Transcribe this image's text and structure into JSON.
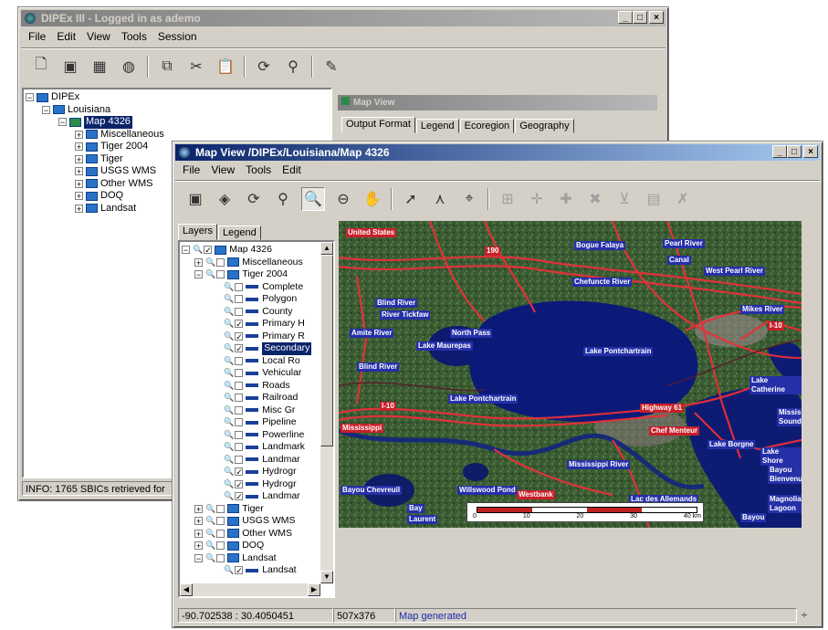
{
  "main_window": {
    "title": "DIPEx III - Logged in as ademo",
    "menus": [
      "File",
      "Edit",
      "View",
      "Tools",
      "Session"
    ],
    "tree": {
      "root": "DIPEx",
      "state": "Louisiana",
      "map": "Map 4326",
      "children": [
        "Miscellaneous",
        "Tiger 2004",
        "Tiger",
        "USGS WMS",
        "Other WMS",
        "DOQ",
        "Landsat"
      ]
    },
    "status": "INFO: 1765 SBICs retrieved for"
  },
  "map_view_panel": {
    "title": "Map View",
    "tabs": [
      "Output Format",
      "Legend",
      "Ecoregion",
      "Geography"
    ]
  },
  "map_window": {
    "title": "Map View /DIPEx/Louisiana/Map 4326",
    "menus": [
      "File",
      "View",
      "Tools",
      "Edit"
    ],
    "tabs": [
      "Layers",
      "Legend"
    ],
    "layers": {
      "map": "Map 4326",
      "misc": "Miscellaneous",
      "tiger2004": "Tiger 2004",
      "sublayers": [
        {
          "name": "Complete",
          "checked": false
        },
        {
          "name": "Polygon",
          "checked": false
        },
        {
          "name": "County",
          "checked": false
        },
        {
          "name": "Primary H",
          "checked": true
        },
        {
          "name": "Primary R",
          "checked": true
        },
        {
          "name": "Secondary",
          "checked": true,
          "selected": true
        },
        {
          "name": "Local Ro",
          "checked": false
        },
        {
          "name": "Vehicular",
          "checked": false
        },
        {
          "name": "Roads",
          "checked": false
        },
        {
          "name": "Railroad",
          "checked": false
        },
        {
          "name": "Misc Gr",
          "checked": false
        },
        {
          "name": "Pipeline",
          "checked": false
        },
        {
          "name": "Powerline",
          "checked": false
        },
        {
          "name": "Landmark",
          "checked": false
        },
        {
          "name": "Landmar",
          "checked": false
        },
        {
          "name": "Hydrogr",
          "checked": true
        },
        {
          "name": "Hydrogr",
          "checked": true
        },
        {
          "name": "Landmar",
          "checked": true
        }
      ],
      "groups_after": [
        "Tiger",
        "USGS WMS",
        "Other WMS",
        "DOQ",
        "Landsat"
      ],
      "last_sub": "Landsat"
    },
    "status": {
      "coords": "-90.702538 : 30.4050451",
      "size": "507x376",
      "message": "Map generated"
    }
  },
  "map_labels": {
    "united_states": "United States",
    "highway_190": "190",
    "bogue_falaya": "Bogue Falaya",
    "chefuncte": "Chefuncte River",
    "pearl_river": "Pearl River",
    "canal": "Canal",
    "west_pearl": "West Pearl River",
    "mikes_river": "Mikes River",
    "i10_east": "I-10",
    "blind_river_top": "Blind River",
    "amite_river": "Amite River",
    "tickfaw": "River Tickfaw",
    "lake_maurepas": "Lake Maurepas",
    "north_pass": "North Pass",
    "lake_pontchartrain": "Lake Pontchartrain",
    "blind_river": "Blind River",
    "lake_pontchartrain_small": "Lake Pontchartrain",
    "i10_west": "I-10",
    "mississippi_left": "Mississippi",
    "highway_61": "Highway 61",
    "chef_menteur": "Chef Menteur",
    "lake_borgne": "Lake Borgne",
    "lake_catherine": "Lake Catherine",
    "mississippi_sound": "Mississippi Sound",
    "lake_shore": "Lake Shore",
    "bayou_bienvenue": "Bayou Bienvenue",
    "mississippi_river": "Mississippi River",
    "bayou_chevreuil": "Bayou Chevreuil",
    "willswood": "Willswood Pond",
    "westbank": "Westbank",
    "lac_des_allemands": "Lac des Allemands",
    "bay": "Bay",
    "laurent": "Laurent",
    "magnolia": "Magnolia Lagoon",
    "bayou": "Bayou",
    "scale_ticks": [
      "0",
      "10",
      "20",
      "30",
      "40 km"
    ]
  },
  "colors": {
    "title_active": "#0a246a",
    "water": "#0c1a6e",
    "road": "#e8303a",
    "label_bg": "#2530a8"
  }
}
